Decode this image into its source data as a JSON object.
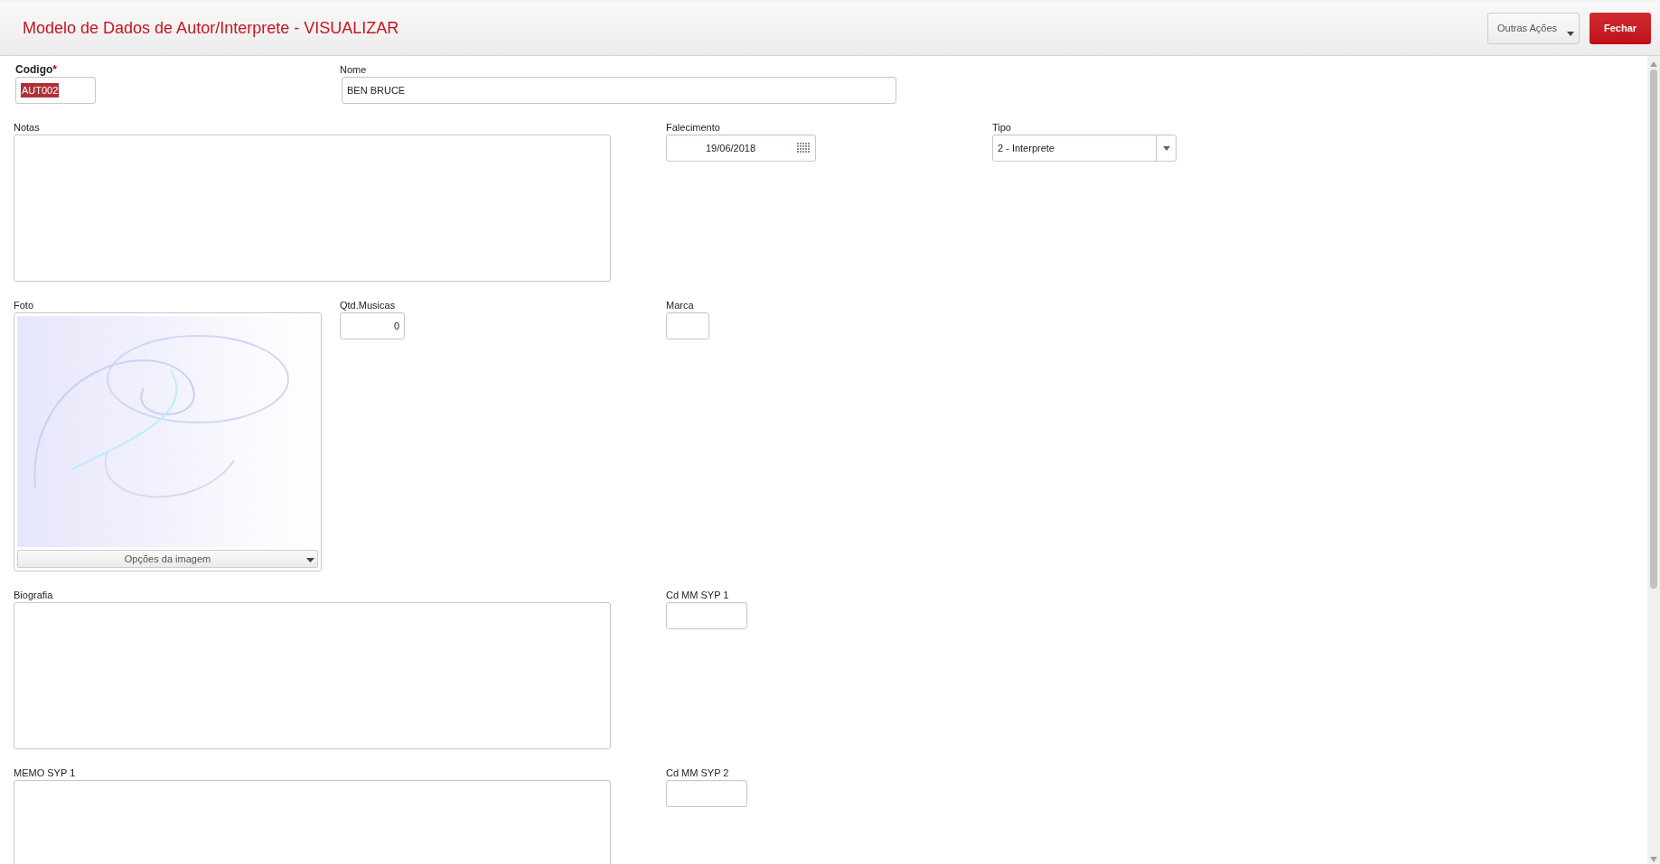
{
  "header": {
    "title": "Modelo de Dados de Autor/Interprete - VISUALIZAR",
    "buttons": [
      {
        "kind": "menu",
        "label": "Outras Ações"
      },
      {
        "kind": "primary",
        "label": "Fechar"
      }
    ]
  },
  "rows": [
    [
      {
        "kind": "text",
        "label": "Codigo",
        "required_mark": "*",
        "value": "AUT002",
        "text_selected": true
      },
      {
        "kind": "text",
        "label": "Nome",
        "value": "BEN BRUCE"
      }
    ],
    [
      {
        "kind": "textarea",
        "label": "Notas"
      },
      {
        "kind": "date",
        "label": "Falecimento",
        "value": "19/06/2018"
      },
      {
        "kind": "select",
        "label": "Tipo",
        "value": "2 - Interprete"
      }
    ],
    [
      {
        "kind": "image",
        "label": "Foto",
        "button": "Opções da imagem"
      },
      {
        "kind": "number",
        "label": "Qtd.Musicas",
        "value": "0"
      },
      {
        "kind": "text",
        "label": "Marca"
      }
    ],
    [
      {
        "kind": "textarea",
        "label": "Biografia"
      },
      {
        "kind": "text",
        "label": "Cd MM SYP 1"
      }
    ],
    [
      {
        "kind": "textarea",
        "label": "MEMO SYP 1"
      },
      {
        "kind": "text",
        "label": "Cd MM SYP 2"
      }
    ]
  ]
}
